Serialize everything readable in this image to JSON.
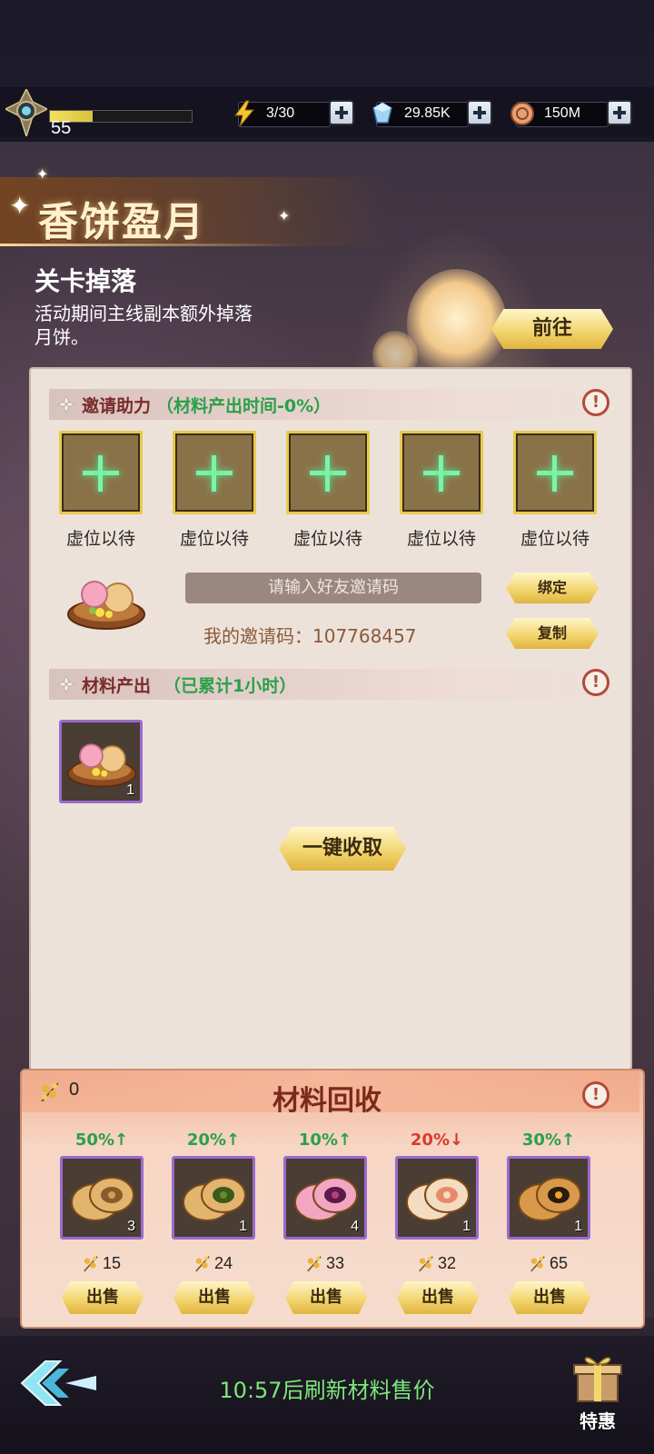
{
  "topbar": {
    "level": "55",
    "xp_fraction": 0.3,
    "energy": "3/30",
    "gems": "29.85K",
    "coins": "150M"
  },
  "event": {
    "title": "香饼盈月",
    "section_title": "关卡掉落",
    "section_desc": "活动期间主线副本额外掉落月饼。",
    "goto_label": "前往"
  },
  "invite": {
    "header_label": "邀请助力",
    "header_sub": "（材料产出时间-0%）",
    "slot_label": "虚位以待",
    "slots": [
      "虚位以待",
      "虚位以待",
      "虚位以待",
      "虚位以待",
      "虚位以待"
    ],
    "input_placeholder": "请输入好友邀请码",
    "my_code": "我的邀请码：107768457",
    "bind_label": "绑定",
    "copy_label": "复制"
  },
  "output": {
    "header_label": "材料产出",
    "header_sub": "（已累计1小时）",
    "item_count": "1",
    "collect_label": "一键收取"
  },
  "recycle": {
    "title": "材料回收",
    "coin_count": "0",
    "items": [
      {
        "pct": "50%↑",
        "trend": "up",
        "count": "3",
        "price": "15",
        "sell": "出售"
      },
      {
        "pct": "20%↑",
        "trend": "up",
        "count": "1",
        "price": "24",
        "sell": "出售"
      },
      {
        "pct": "10%↑",
        "trend": "up",
        "count": "4",
        "price": "33",
        "sell": "出售"
      },
      {
        "pct": "20%↓",
        "trend": "down",
        "count": "1",
        "price": "32",
        "sell": "出售"
      },
      {
        "pct": "30%↑",
        "trend": "up",
        "count": "1",
        "price": "65",
        "sell": "出售"
      }
    ]
  },
  "footer": {
    "refresh_text": "10:57后刷新材料售价",
    "special_label": "特惠"
  },
  "colors": {
    "up": "#2aa04a",
    "down": "#d83a2e",
    "accent_gold": "#f1d36a"
  }
}
